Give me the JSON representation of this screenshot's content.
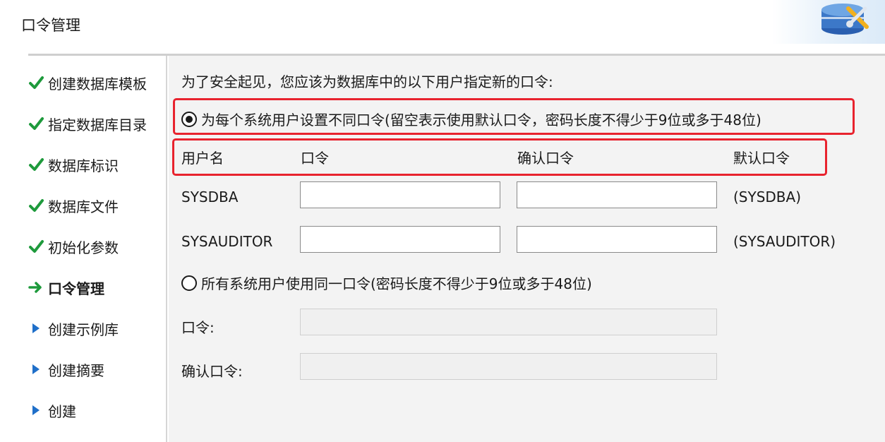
{
  "header": {
    "title": "口令管理",
    "logo_icon": "database-tools-icon"
  },
  "sidebar": {
    "items": [
      {
        "label": "创建数据库模板",
        "state": "done"
      },
      {
        "label": "指定数据库目录",
        "state": "done"
      },
      {
        "label": "数据库标识",
        "state": "done"
      },
      {
        "label": "数据库文件",
        "state": "done"
      },
      {
        "label": "初始化参数",
        "state": "done"
      },
      {
        "label": "口令管理",
        "state": "current"
      },
      {
        "label": "创建示例库",
        "state": "pending"
      },
      {
        "label": "创建摘要",
        "state": "pending"
      },
      {
        "label": "创建",
        "state": "pending"
      }
    ]
  },
  "main": {
    "intro": "为了安全起见，您应该为数据库中的以下用户指定新的口令:",
    "option_each": {
      "label": "为每个系统用户设置不同口令(留空表示使用默认口令，密码长度不得少于9位或多于48位)",
      "selected": true
    },
    "columns": {
      "user": "用户名",
      "password": "口令",
      "confirm": "确认口令",
      "default": "默认口令"
    },
    "users": [
      {
        "name": "SYSDBA",
        "password": "",
        "confirm": "",
        "default": "(SYSDBA)"
      },
      {
        "name": "SYSAUDITOR",
        "password": "",
        "confirm": "",
        "default": "(SYSAUDITOR)"
      }
    ],
    "option_same": {
      "label": "所有系统用户使用同一口令(密码长度不得少于9位或多于48位)",
      "selected": false
    },
    "same_password_label": "口令:",
    "same_password_value": "",
    "same_confirm_label": "确认口令:",
    "same_confirm_value": ""
  },
  "colors": {
    "check": "#1e9a3c",
    "arrow": "#1e9a3c",
    "pending": "#1f6fc9",
    "highlight": "#e8232e"
  }
}
